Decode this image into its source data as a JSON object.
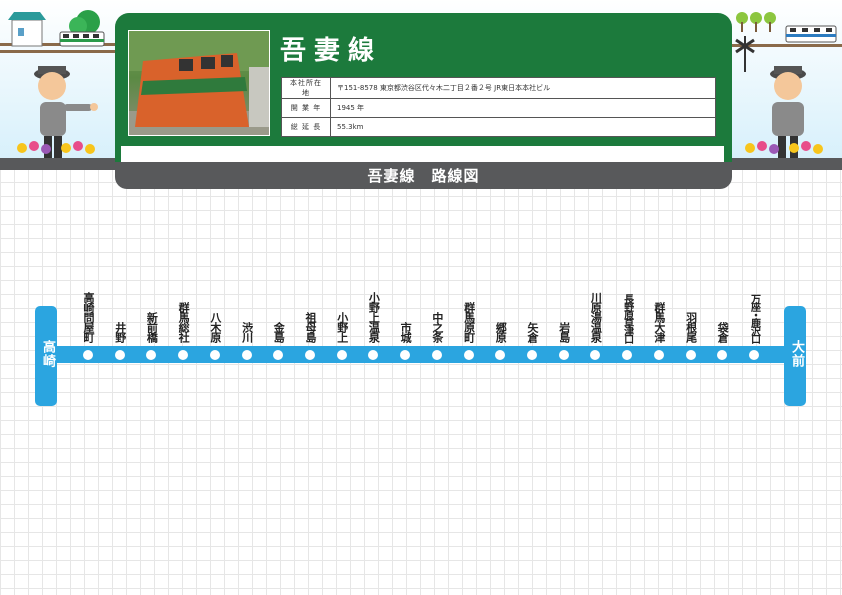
{
  "header": {
    "line_name": "吾妻線",
    "info": [
      {
        "key": "本社所在地",
        "value": "〒151-8578 東京都渋谷区代々木二丁目２番２号 JR東日本本社ビル"
      },
      {
        "key": "開 業 年",
        "value": "1945 年"
      },
      {
        "key": "総 延 長",
        "value": "55.3km"
      }
    ]
  },
  "route": {
    "title": "吾妻線　路線図",
    "start_terminal": "高崎",
    "end_terminal": "大前",
    "line_color": "#2ba5e0",
    "stations": [
      "高崎問屋町",
      "井野",
      "新前橋",
      "群馬総社",
      "八木原",
      "渋川",
      "金島",
      "祖母島",
      "小野上",
      "小野上温泉",
      "市城",
      "中之条",
      "群馬原町",
      "郷原",
      "矢倉",
      "岩島",
      "川原湯温泉",
      "長野原草津口",
      "群馬大津",
      "羽根尾",
      "袋倉",
      "万座・鹿沢口"
    ]
  },
  "colors": {
    "header_green": "#1c7a3c",
    "bar_gray": "#58595b"
  }
}
